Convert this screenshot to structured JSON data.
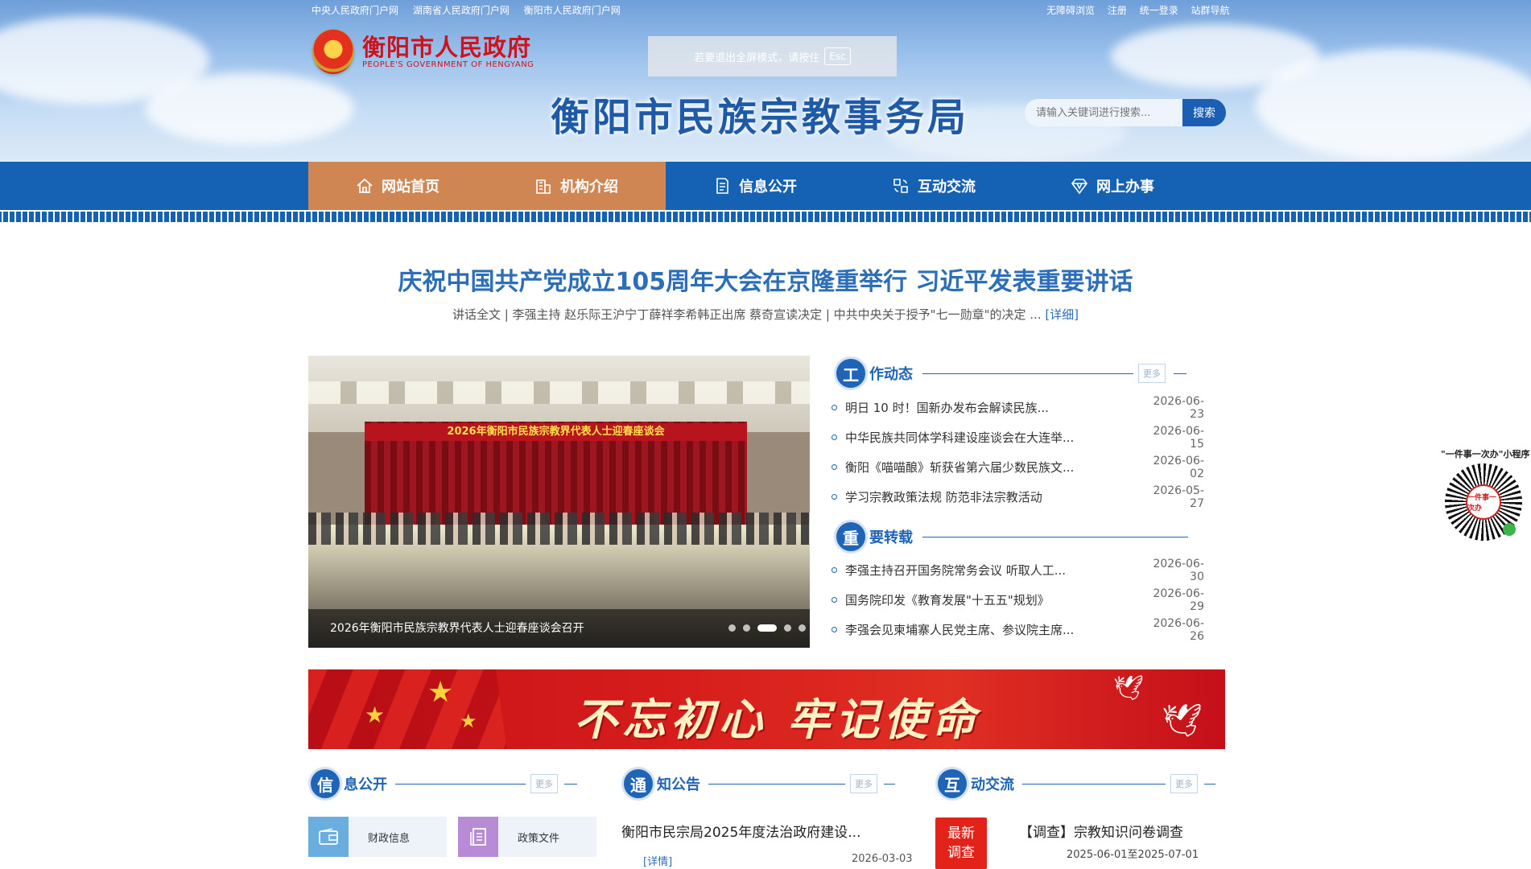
{
  "topbar": {
    "left_links": [
      "中央人民政府门户网",
      "湖南省人民政府门户网",
      "衡阳市人民政府门户网"
    ],
    "right_links": [
      "无障碍浏览",
      "注册",
      "统一登录",
      "站群导航"
    ]
  },
  "logo": {
    "cn": "衡阳市人民政府",
    "en": "PEOPLE'S GOVERNMENT OF HENGYANG"
  },
  "fullscreen_tip": {
    "text": "若要退出全屏模式，请按住",
    "key": "Esc"
  },
  "site_title": "衡阳市民族宗教事务局",
  "search": {
    "placeholder": "请输入关键词进行搜索...",
    "button": "搜索"
  },
  "nav": {
    "items": [
      {
        "label": "网站首页",
        "icon": "home-icon",
        "active": true
      },
      {
        "label": "机构介绍",
        "icon": "building-icon",
        "active": true
      },
      {
        "label": "信息公开",
        "icon": "document-icon",
        "active": false
      },
      {
        "label": "互动交流",
        "icon": "interaction-icon",
        "active": false
      },
      {
        "label": "网上办事",
        "icon": "diamond-icon",
        "active": false
      }
    ]
  },
  "headline": {
    "title": "庆祝中国共产党成立105周年大会在京隆重举行 习近平发表重要讲话",
    "sub": "讲话全文 | 李强主持 赵乐际王沪宁丁薛祥李希韩正出席 蔡奇宣读决定 | 中共中央关于授予\"七一勋章\"的决定",
    "ellipsis": " ... ",
    "more": "[详细]"
  },
  "carousel": {
    "banner_text": "2026年衡阳市民族宗教界代表人士迎春座谈会",
    "caption": "2026年衡阳市民族宗教界代表人士迎春座谈会召开",
    "slide_count": 5,
    "active_index": 2
  },
  "work_news": {
    "badge": "工",
    "title": "作动态",
    "more": "更多",
    "items": [
      {
        "title": "明日 10 时！国新办发布会解读民族...",
        "date": "2026-06-23"
      },
      {
        "title": "中华民族共同体学科建设座谈会在大连举...",
        "date": "2026-06-15"
      },
      {
        "title": "衡阳《喵喵酿》斩获省第六届少数民族文...",
        "date": "2026-06-02"
      },
      {
        "title": "学习宗教政策法规 防范非法宗教活动",
        "date": "2026-05-27"
      }
    ]
  },
  "important": {
    "badge": "重",
    "title": "要转载",
    "items": [
      {
        "title": "李强主持召开国务院常务会议 听取人工...",
        "date": "2026-06-30"
      },
      {
        "title": "国务院印发《教育发展\"十五五\"规划》",
        "date": "2026-06-29"
      },
      {
        "title": "李强会见柬埔寨人民党主席、参议院主席...",
        "date": "2026-06-26"
      }
    ]
  },
  "banner": {
    "text": "不忘初心 牢记使命"
  },
  "info_public": {
    "badge": "信",
    "title": "息公开",
    "more": "更多",
    "tiles": [
      {
        "label": "财政信息",
        "icon": "wallet-icon",
        "color": "#6aaee0"
      },
      {
        "label": "政策文件",
        "icon": "file-stack-icon",
        "color": "#b78bd6"
      }
    ]
  },
  "notices": {
    "badge": "通",
    "title": "知公告",
    "more": "更多",
    "item": {
      "title": "衡阳市民宗局2025年度法治政府建设...",
      "detail": "[详情]",
      "date": "2026-03-03"
    }
  },
  "interaction": {
    "badge": "互",
    "title": "动交流",
    "more": "更多",
    "survey_badge": [
      "最新",
      "调查"
    ],
    "survey_title": "【调查】宗教知识问卷调查",
    "survey_date": "2025-06-01至2025-07-01"
  },
  "side_qr": {
    "label": "\"一件事一次办\"小程序",
    "center": "一件事一次办"
  },
  "colors": {
    "primary": "#1561b3",
    "active_nav": "#cf8652",
    "title_blue": "#2d6eb8",
    "red": "#d0121b"
  }
}
